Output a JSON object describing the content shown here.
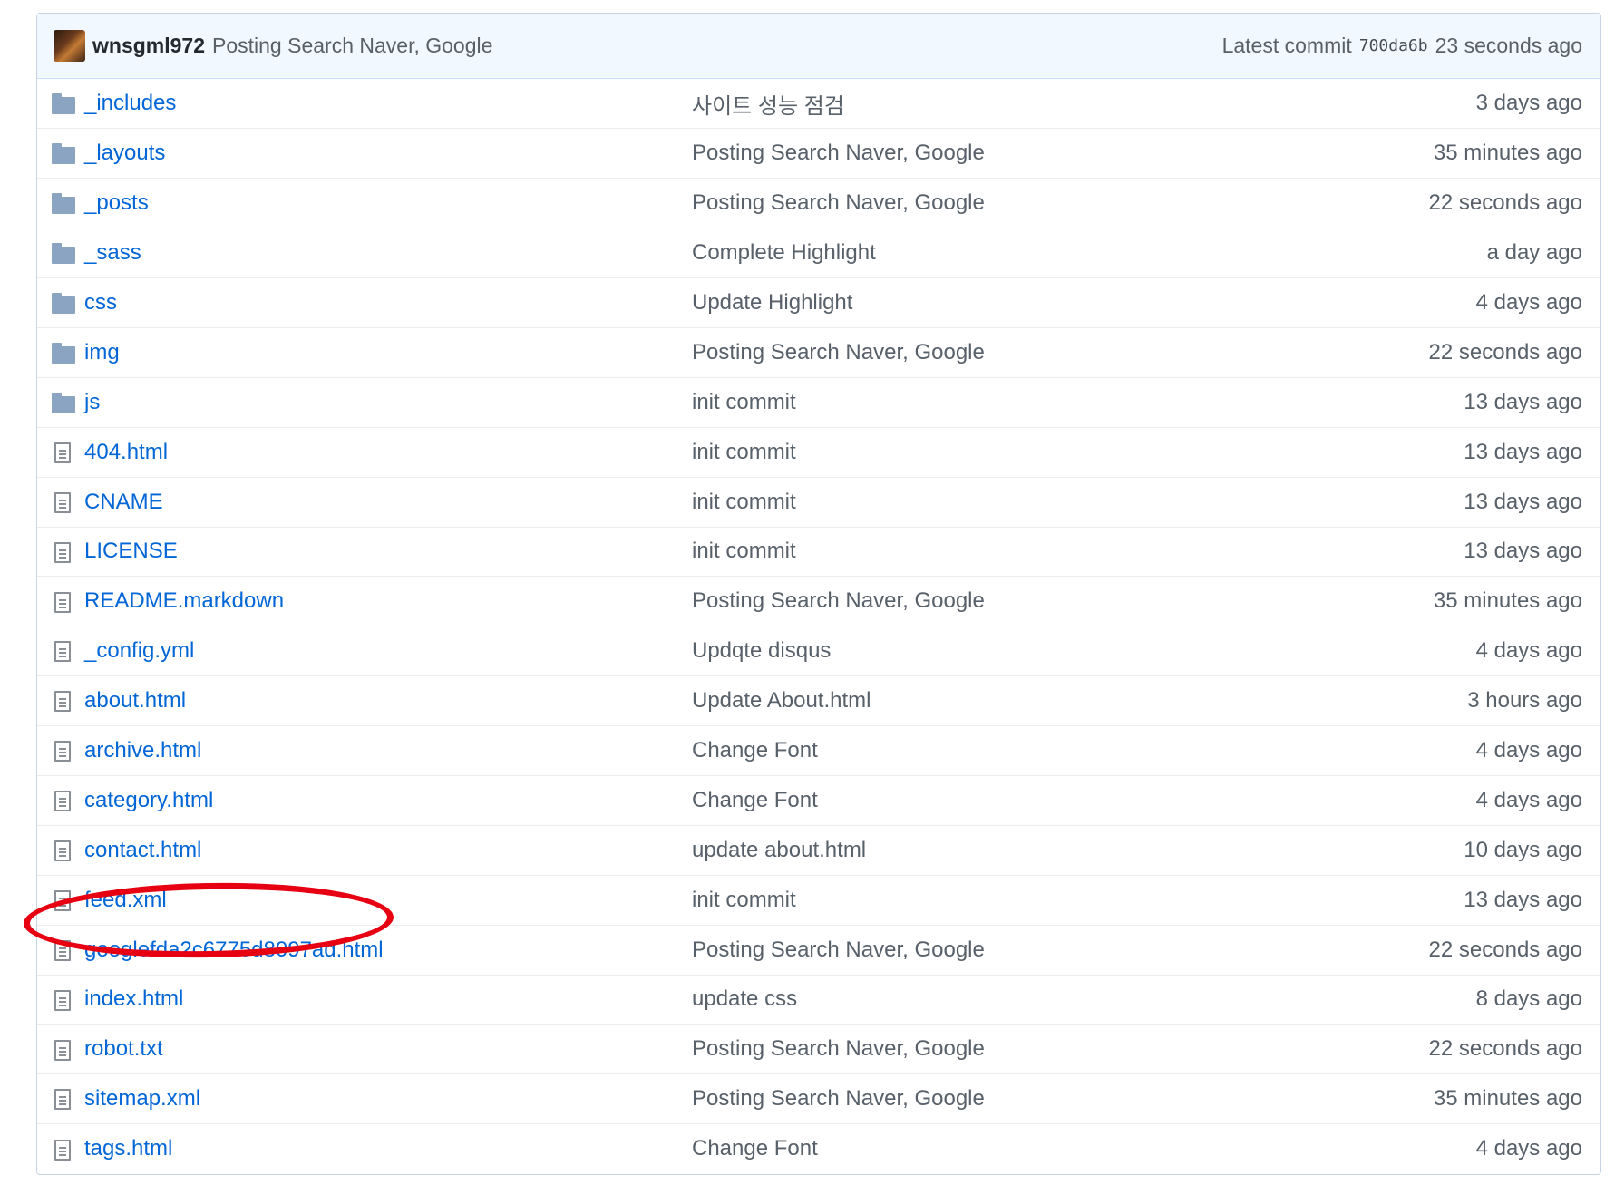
{
  "commit": {
    "author": "wnsgml972",
    "message": "Posting Search Naver, Google",
    "latest_label": "Latest commit",
    "sha": "700da6b",
    "age": "23 seconds ago"
  },
  "files": [
    {
      "type": "folder",
      "name": "_includes",
      "message": "사이트 성능 점검",
      "age": "3 days ago"
    },
    {
      "type": "folder",
      "name": "_layouts",
      "message": "Posting Search Naver, Google",
      "age": "35 minutes ago"
    },
    {
      "type": "folder",
      "name": "_posts",
      "message": "Posting Search Naver, Google",
      "age": "22 seconds ago"
    },
    {
      "type": "folder",
      "name": "_sass",
      "message": "Complete Highlight",
      "age": "a day ago"
    },
    {
      "type": "folder",
      "name": "css",
      "message": "Update Highlight",
      "age": "4 days ago"
    },
    {
      "type": "folder",
      "name": "img",
      "message": "Posting Search Naver, Google",
      "age": "22 seconds ago"
    },
    {
      "type": "folder",
      "name": "js",
      "message": "init commit",
      "age": "13 days ago"
    },
    {
      "type": "file",
      "name": "404.html",
      "message": "init commit",
      "age": "13 days ago"
    },
    {
      "type": "file",
      "name": "CNAME",
      "message": "init commit",
      "age": "13 days ago"
    },
    {
      "type": "file",
      "name": "LICENSE",
      "message": "init commit",
      "age": "13 days ago"
    },
    {
      "type": "file",
      "name": "README.markdown",
      "message": "Posting Search Naver, Google",
      "age": "35 minutes ago"
    },
    {
      "type": "file",
      "name": "_config.yml",
      "message": "Updqte disqus",
      "age": "4 days ago"
    },
    {
      "type": "file",
      "name": "about.html",
      "message": "Update About.html",
      "age": "3 hours ago"
    },
    {
      "type": "file",
      "name": "archive.html",
      "message": "Change Font",
      "age": "4 days ago"
    },
    {
      "type": "file",
      "name": "category.html",
      "message": "Change Font",
      "age": "4 days ago"
    },
    {
      "type": "file",
      "name": "contact.html",
      "message": "update about.html",
      "age": "10 days ago"
    },
    {
      "type": "file",
      "name": "feed.xml",
      "message": "init commit",
      "age": "13 days ago"
    },
    {
      "type": "file",
      "name": "googlefda2c6775d8097ad.html",
      "message": "Posting Search Naver, Google",
      "age": "22 seconds ago"
    },
    {
      "type": "file",
      "name": "index.html",
      "message": "update css",
      "age": "8 days ago"
    },
    {
      "type": "file",
      "name": "robot.txt",
      "message": "Posting Search Naver, Google",
      "age": "22 seconds ago"
    },
    {
      "type": "file",
      "name": "sitemap.xml",
      "message": "Posting Search Naver, Google",
      "age": "35 minutes ago"
    },
    {
      "type": "file",
      "name": "tags.html",
      "message": "Change Font",
      "age": "4 days ago"
    }
  ],
  "annotation": {
    "color": "#e60012",
    "highlighted_file": "googlefda2c6775d8097ad.html"
  },
  "colors": {
    "link": "#0366d6",
    "header_bg": "#f1f8ff",
    "muted_text": "#586069"
  }
}
